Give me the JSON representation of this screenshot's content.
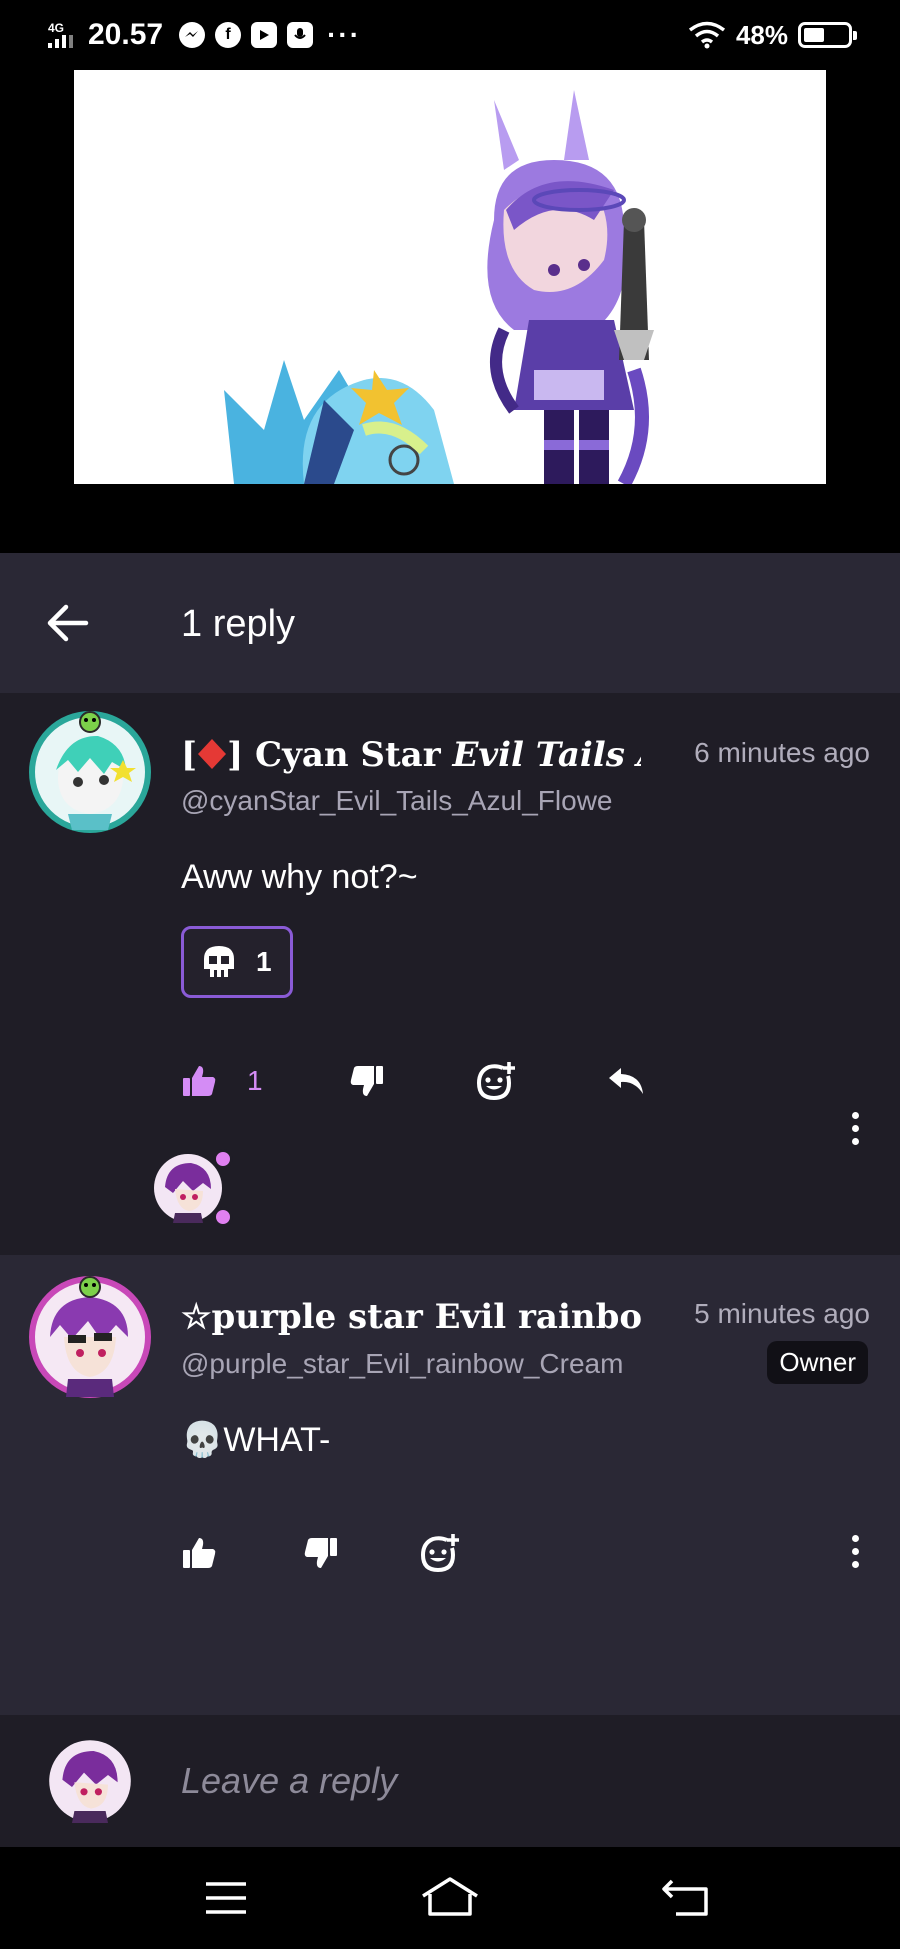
{
  "status_bar": {
    "network": "4G",
    "time": "20.57",
    "more": "···",
    "battery_pct": "48%",
    "battery_level": 0.48
  },
  "header": {
    "title": "1 reply"
  },
  "comments": [
    {
      "name_prefix": "[",
      "name_suffix": "] Cyan Star ",
      "name_italic": "Evil Tails A",
      "time": "6 minutes ago",
      "handle": "@cyanStar_Evil_Tails_Azul_Flowe",
      "text": "Aww why not?~",
      "reaction_count": "1",
      "like_count": "1"
    },
    {
      "name": "☆purple star Evil rainbow",
      "time": "5 minutes ago",
      "handle": "@purple_star_Evil_rainbow_Cream",
      "badge": "Owner",
      "text": "💀WHAT-"
    }
  ],
  "reply_input": {
    "placeholder": "Leave a reply"
  },
  "colors": {
    "header_bg": "#2a2835",
    "comment_bg": "#1f1d26",
    "accent": "#d48cf5",
    "reaction_border": "#8a5bd6"
  },
  "icons": [
    "back-arrow-icon",
    "thumbs-up-icon",
    "thumbs-down-icon",
    "add-reaction-icon",
    "reply-icon",
    "more-vertical-icon",
    "skull-icon",
    "menu-icon",
    "home-icon",
    "back-icon"
  ]
}
